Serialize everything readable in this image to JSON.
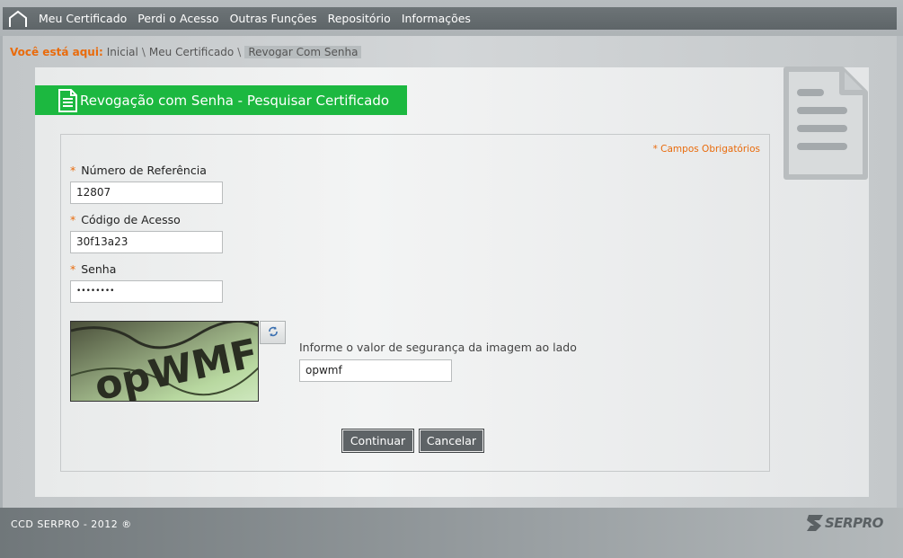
{
  "nav": {
    "home_icon": "home-icon",
    "items": [
      "Meu Certificado",
      "Perdi o Acesso",
      "Outras Funções",
      "Repositório",
      "Informações"
    ]
  },
  "breadcrumb": {
    "label": "Você está aqui:",
    "items": [
      "Inicial",
      "Meu Certificado",
      "Revogar Com Senha"
    ],
    "separator": "\\"
  },
  "page": {
    "title": "Revogação com Senha - Pesquisar Certificado",
    "title_color": "#1cb840",
    "accent_color": "#e96b0c"
  },
  "form": {
    "required_note": "* Campos Obrigatórios",
    "required_marker": "*",
    "fields": [
      {
        "label": "Número de Referência",
        "value": "12807"
      },
      {
        "label": "Código de Acesso",
        "value": "30f13a23"
      },
      {
        "label": "Senha",
        "value": "••••••••"
      }
    ],
    "captcha": {
      "image_text": "opWMF",
      "refresh_icon": "refresh-icon",
      "label": "Informe o valor de segurança da imagem ao lado",
      "value": "opwmf"
    },
    "buttons": {
      "continue": "Continuar",
      "cancel": "Cancelar"
    }
  },
  "footer": {
    "copyright": "CCD SERPRO - 2012 ®",
    "logo_text": "SERPRO"
  }
}
